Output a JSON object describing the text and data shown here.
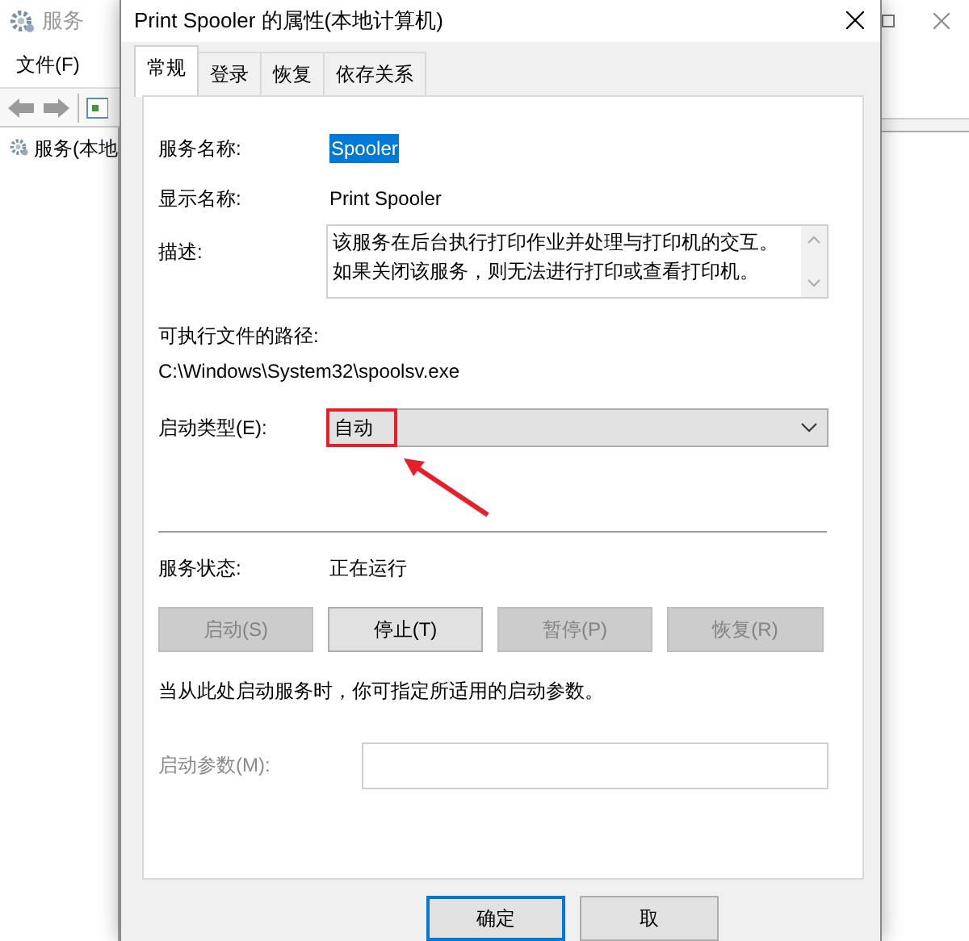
{
  "background_window": {
    "title": "服务",
    "menu": [
      "文件(F)"
    ],
    "tree_item": "服务(本地"
  },
  "dialog": {
    "title": "Print Spooler 的属性(本地计算机)",
    "tabs": [
      {
        "label": "常规",
        "selected": true
      },
      {
        "label": "登录",
        "selected": false
      },
      {
        "label": "恢复",
        "selected": false
      },
      {
        "label": "依存关系",
        "selected": false
      }
    ],
    "general": {
      "service_name": {
        "label": "服务名称:",
        "value": "Spooler",
        "selected": true
      },
      "display_name": {
        "label": "显示名称:",
        "value": "Print Spooler"
      },
      "description": {
        "label": "描述:",
        "value": "该服务在后台执行打印作业并处理与打印机的交互。如果关闭该服务，则无法进行打印或查看打印机。"
      },
      "path": {
        "label": "可执行文件的路径:",
        "value": "C:\\Windows\\System32\\spoolsv.exe"
      },
      "startup_type": {
        "label": "启动类型(E):",
        "value": "自动",
        "highlighted": true
      },
      "status": {
        "label": "服务状态:",
        "value": "正在运行"
      },
      "service_buttons": [
        {
          "label": "启动(S)",
          "disabled": true
        },
        {
          "label": "停止(T)",
          "disabled": false
        },
        {
          "label": "暂停(P)",
          "disabled": true
        },
        {
          "label": "恢复(R)",
          "disabled": true
        }
      ],
      "hint": "当从此处启动服务时，你可指定所适用的启动参数。",
      "start_parameters": {
        "label": "启动参数(M):",
        "disabled": true
      }
    },
    "footer_buttons": [
      {
        "label": "确定",
        "default": true
      },
      {
        "label": "取",
        "default": false
      }
    ]
  }
}
